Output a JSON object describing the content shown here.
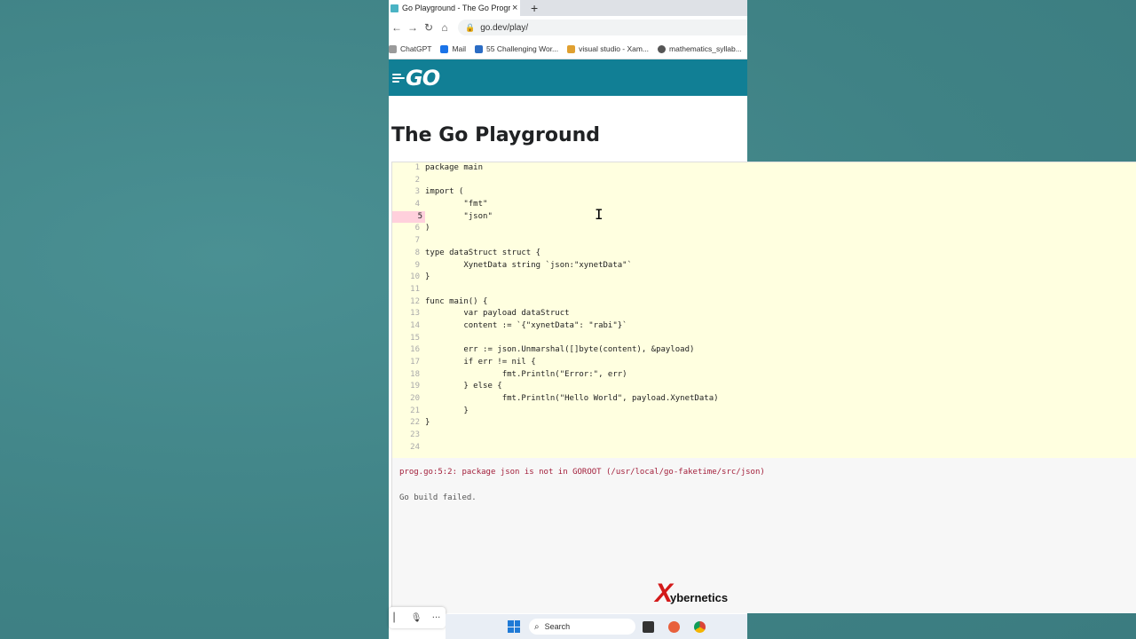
{
  "browser": {
    "tab_title": "Go Playground - The Go Programming Language",
    "tab_close": "×",
    "new_tab": "+",
    "url": "go.dev/play/",
    "bookmarks": [
      {
        "label": "ChatGPT",
        "color": "#9a9a9a"
      },
      {
        "label": "Mail",
        "color": "#1a73e8"
      },
      {
        "label": "55 Challenging Wor...",
        "color": "#2b6cc4"
      },
      {
        "label": "visual studio - Xam...",
        "color": "#e0a030"
      },
      {
        "label": "mathematics_syllab...",
        "color": "#555555"
      }
    ]
  },
  "header": {
    "logo": "GO"
  },
  "page": {
    "title": "The Go Playground"
  },
  "editor": {
    "error_line": 5,
    "lines": [
      {
        "n": "1",
        "code": "package main"
      },
      {
        "n": "2",
        "code": ""
      },
      {
        "n": "3",
        "code": "import ("
      },
      {
        "n": "4",
        "code": "        \"fmt\""
      },
      {
        "n": "5",
        "code": "        \"json\""
      },
      {
        "n": "6",
        "code": ")"
      },
      {
        "n": "7",
        "code": ""
      },
      {
        "n": "8",
        "code": "type dataStruct struct {"
      },
      {
        "n": "9",
        "code": "        XynetData string `json:\"xynetData\"`"
      },
      {
        "n": "10",
        "code": "}"
      },
      {
        "n": "11",
        "code": ""
      },
      {
        "n": "12",
        "code": "func main() {"
      },
      {
        "n": "13",
        "code": "        var payload dataStruct"
      },
      {
        "n": "14",
        "code": "        content := `{\"xynetData\": \"rabi\"}`"
      },
      {
        "n": "15",
        "code": ""
      },
      {
        "n": "16",
        "code": "        err := json.Unmarshal([]byte(content), &payload)"
      },
      {
        "n": "17",
        "code": "        if err != nil {"
      },
      {
        "n": "18",
        "code": "                fmt.Println(\"Error:\", err)"
      },
      {
        "n": "19",
        "code": "        } else {"
      },
      {
        "n": "20",
        "code": "                fmt.Println(\"Hello World\", payload.XynetData)"
      },
      {
        "n": "21",
        "code": "        }"
      },
      {
        "n": "22",
        "code": "}"
      },
      {
        "n": "23",
        "code": ""
      },
      {
        "n": "24",
        "code": ""
      }
    ]
  },
  "output": {
    "error": "prog.go:5:2: package json is not in GOROOT (/usr/local/go-faketime/src/json)",
    "status": "Go build failed."
  },
  "watermark": {
    "mark": "X",
    "text": "ybernetics"
  },
  "taskbar": {
    "search_label": "Search"
  },
  "colors": {
    "go_header": "#117f95",
    "editor_bg": "#ffffe0",
    "error_text": "#a3203c",
    "error_line_bg": "#ffd0dc"
  }
}
